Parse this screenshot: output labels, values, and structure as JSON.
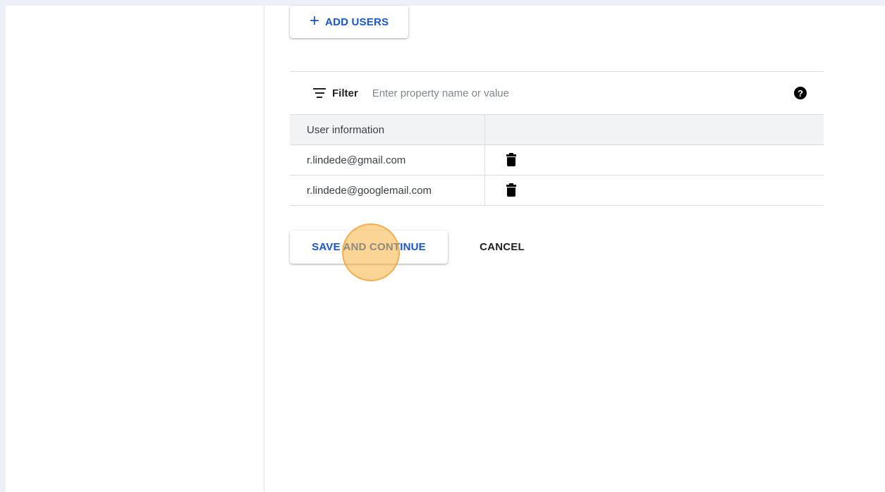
{
  "toolbar": {
    "add_users_label": "ADD USERS"
  },
  "filter": {
    "label": "Filter",
    "placeholder": "Enter property name or value",
    "help_glyph": "?"
  },
  "table": {
    "columns": [
      "User information",
      ""
    ],
    "rows": [
      {
        "email": "r.lindede@gmail.com"
      },
      {
        "email": "r.lindede@googlemail.com"
      }
    ]
  },
  "actions": {
    "save_label": "SAVE AND CONTINUE",
    "cancel_label": "CANCEL"
  },
  "colors": {
    "primary": "#1a56c8",
    "page_background": "#eef0f8",
    "click_marker": "#f7b240"
  },
  "icons": {
    "add": "plus-icon",
    "filter": "filter-icon",
    "help": "help-icon",
    "delete": "trash-icon"
  }
}
